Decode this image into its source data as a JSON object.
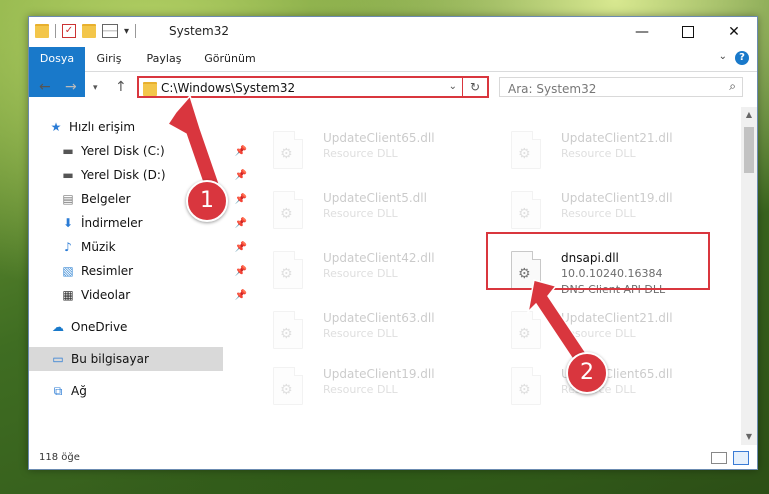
{
  "window": {
    "title": "System32"
  },
  "ribbon": {
    "tabs": [
      "Dosya",
      "Giriş",
      "Paylaş",
      "Görünüm"
    ],
    "help_label": "?"
  },
  "nav": {
    "address_path": "C:\\Windows\\System32",
    "search_placeholder": "Ara: System32"
  },
  "sidebar": {
    "items": [
      {
        "label": "Hızlı erişim",
        "icon": "star-icon"
      },
      {
        "label": "Yerel Disk (C:)",
        "icon": "drive-icon",
        "pinned": true
      },
      {
        "label": "Yerel Disk (D:)",
        "icon": "drive-icon",
        "pinned": true
      },
      {
        "label": "Belgeler",
        "icon": "documents-icon",
        "pinned": true
      },
      {
        "label": "İndirmeler",
        "icon": "download-icon",
        "pinned": true
      },
      {
        "label": "Müzik",
        "icon": "music-icon",
        "pinned": true
      },
      {
        "label": "Resimler",
        "icon": "pictures-icon",
        "pinned": true
      },
      {
        "label": "Videolar",
        "icon": "video-icon",
        "pinned": true
      },
      {
        "label": "OneDrive",
        "icon": "cloud-icon"
      },
      {
        "label": "Bu bilgisayar",
        "icon": "computer-icon",
        "selected": true
      },
      {
        "label": "Ağ",
        "icon": "network-icon"
      }
    ]
  },
  "files": [
    {
      "name": "UpdateClient65.dll",
      "line2": "Resource DLL",
      "faded": true
    },
    {
      "name": "UpdateClient21.dll",
      "line2": "Resource DLL",
      "faded": true
    },
    {
      "name": "UpdateClient5.dll",
      "line2": "Resource DLL",
      "faded": true
    },
    {
      "name": "UpdateClient19.dll",
      "line2": "Resource DLL",
      "faded": true
    },
    {
      "name": "UpdateClient42.dll",
      "line2": "Resource DLL",
      "faded": true
    },
    {
      "name": "dnsapi.dll",
      "line2": "10.0.10240.16384",
      "line3": "DNS Client API DLL",
      "faded": false
    },
    {
      "name": "UpdateClient63.dll",
      "line2": "Resource DLL",
      "faded": true
    },
    {
      "name": "UpdateClient21.dll",
      "line2": "Resource DLL",
      "faded": true
    },
    {
      "name": "UpdateClient19.dll",
      "line2": "Resource DLL",
      "faded": true
    },
    {
      "name": "UpdateClient65.dll",
      "line2": "Resource DLL",
      "faded": true
    }
  ],
  "status": {
    "item_count": "118 öğe"
  },
  "annotations": {
    "step1": "1",
    "step2": "2"
  },
  "colors": {
    "accent": "#1979ca",
    "highlight": "#d9363e",
    "selection": "#cce8ff"
  }
}
